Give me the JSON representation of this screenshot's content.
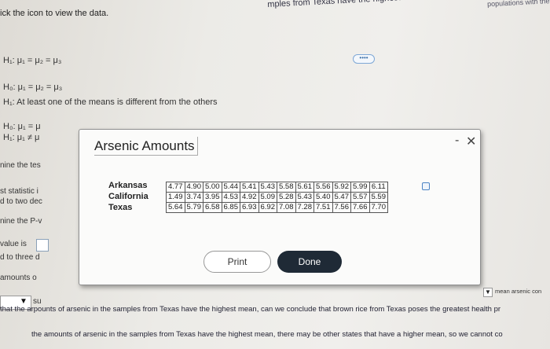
{
  "background": {
    "question_top": "mples from Texas have the highest mean, can we conclude that brown",
    "question_top_right": "populations with the s",
    "instruction": "ick the icon to view the data.",
    "h1_first": "H₁: μ₁ = μ₂ = μ₃",
    "h0_line": "H₀: μ₁ = μ₂ = μ₃",
    "h1_line": "H₁: At least one of the means is different from the others",
    "h0_partial": "H₀: μ₁ = μ",
    "h1_partial": "H₁: μ₁ ≠ μ",
    "ellipsis": "••••",
    "side_1": "nine the tes",
    "side_2": "st statistic i",
    "side_3": "d to two dec",
    "side_4": "nine the P-v",
    "side_5": "value is",
    "side_6": "d to three d",
    "side_7": "amounts o",
    "dropdown_text": "su",
    "right_small": "mean arsenic con",
    "bottom_1": "that the arpounts of arsenic in the samples from Texas have the highest mean, can we conclude that brown rice from Texas poses the greatest health pr",
    "bottom_2": "the amounts of arsenic in the samples from Texas have the highest mean, there may be other states that have a higher mean, so we cannot co"
  },
  "modal": {
    "title": "Arsenic Amounts",
    "minimize": "-",
    "close": "✕",
    "rows": [
      {
        "label": "Arkansas",
        "values": [
          "4.77",
          "4.90",
          "5.00",
          "5.44",
          "5.41",
          "5.43",
          "5.58",
          "5.61",
          "5.56",
          "5.92",
          "5.99",
          "6.11"
        ]
      },
      {
        "label": "California",
        "values": [
          "1.49",
          "3.74",
          "3.95",
          "4.53",
          "4.92",
          "5.09",
          "5.28",
          "5.43",
          "5.40",
          "5.47",
          "5.57",
          "5.59"
        ]
      },
      {
        "label": "Texas",
        "values": [
          "5.64",
          "5.79",
          "6.58",
          "6.85",
          "6.93",
          "6.92",
          "7.08",
          "7.28",
          "7.51",
          "7.56",
          "7.66",
          "7.70"
        ]
      }
    ],
    "print_label": "Print",
    "done_label": "Done"
  },
  "colors": {
    "done_button": "#1f2a36",
    "accent_blue": "#4b83c4"
  }
}
